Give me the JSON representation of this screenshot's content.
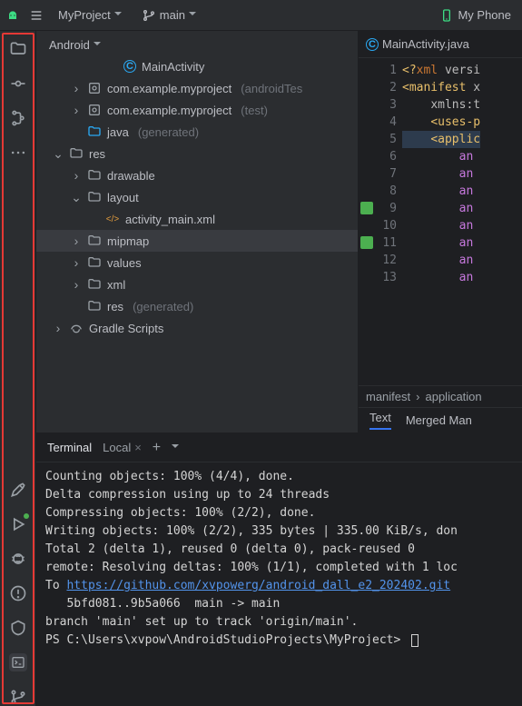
{
  "topbar": {
    "project": "MyProject",
    "branch": "main",
    "device": "My Phone"
  },
  "project_view": {
    "mode": "Android",
    "nodes": [
      {
        "depth": 3,
        "exp": "none",
        "icon": "class",
        "label": "MainActivity"
      },
      {
        "depth": 1,
        "exp": "closed",
        "icon": "pkg",
        "label": "com.example.myproject",
        "suffix": "(androidTes"
      },
      {
        "depth": 1,
        "exp": "closed",
        "icon": "pkg",
        "label": "com.example.myproject",
        "suffix": "(test)"
      },
      {
        "depth": 1,
        "exp": "none",
        "icon": "javadir",
        "label": "java",
        "suffix": "(generated)"
      },
      {
        "depth": 0,
        "exp": "open",
        "icon": "folder",
        "label": "res"
      },
      {
        "depth": 1,
        "exp": "closed",
        "icon": "folder",
        "label": "drawable"
      },
      {
        "depth": 1,
        "exp": "open",
        "icon": "folder",
        "label": "layout"
      },
      {
        "depth": 2,
        "exp": "none",
        "icon": "xml",
        "label": "activity_main.xml"
      },
      {
        "depth": 1,
        "exp": "closed",
        "icon": "folder",
        "label": "mipmap",
        "selected": true
      },
      {
        "depth": 1,
        "exp": "closed",
        "icon": "folder",
        "label": "values"
      },
      {
        "depth": 1,
        "exp": "closed",
        "icon": "folder",
        "label": "xml"
      },
      {
        "depth": 1,
        "exp": "none",
        "icon": "folder",
        "label": "res",
        "suffix": "(generated)"
      },
      {
        "depth": 0,
        "exp": "closed",
        "icon": "gradle",
        "label": "Gradle Scripts"
      }
    ]
  },
  "editor": {
    "tab": "MainActivity.java",
    "lines": [
      {
        "n": 1,
        "html": "<span class='t-ang'>&lt;?</span><span class='t-pi'>xml</span> <span class='t-attr'>versi</span>"
      },
      {
        "n": 2,
        "html": "<span class='t-ang'>&lt;</span><span class='t-tag'>manifest</span> <span class='t-attr'>x</span>"
      },
      {
        "n": 3,
        "html": "    <span class='t-attr'>xmlns:t</span>"
      },
      {
        "n": 4,
        "html": "    <span class='t-ang'>&lt;</span><span class='t-tag'>uses-p</span>"
      },
      {
        "n": 5,
        "hl": true,
        "html": "    <span class='t-ang'>&lt;</span><span class='t-app'>applic</span>"
      },
      {
        "n": 6,
        "html": "        <span class='t-an'>an</span>"
      },
      {
        "n": 7,
        "html": "        <span class='t-an'>an</span>"
      },
      {
        "n": 8,
        "html": "        <span class='t-an'>an</span>"
      },
      {
        "n": 9,
        "gicon": true,
        "html": "        <span class='t-an'>an</span>"
      },
      {
        "n": 10,
        "html": "        <span class='t-an'>an</span>"
      },
      {
        "n": 11,
        "gicon": true,
        "html": "        <span class='t-an'>an</span>"
      },
      {
        "n": 12,
        "html": "        <span class='t-an'>an</span>"
      },
      {
        "n": 13,
        "html": "        <span class='t-an'>an</span>"
      }
    ],
    "breadcrumb": [
      "manifest",
      "application"
    ],
    "bottom_tabs": [
      "Text",
      "Merged Man"
    ]
  },
  "terminal": {
    "title": "Terminal",
    "tab": "Local",
    "lines": [
      "Counting objects: 100% (4/4), done.",
      "Delta compression using up to 24 threads",
      "Compressing objects: 100% (2/2), done.",
      "Writing objects: 100% (2/2), 335 bytes | 335.00 KiB/s, don",
      "Total 2 (delta 1), reused 0 (delta 0), pack-reused 0",
      "remote: Resolving deltas: 100% (1/1), completed with 1 loc"
    ],
    "link_prefix": "To ",
    "link": "https://github.com/xvpowerg/android_dall_e2_202402.git",
    "after_link": [
      "   5bfd081..9b5a066  main -> main",
      "branch 'main' set up to track 'origin/main'."
    ],
    "prompt": "PS C:\\Users\\xvpow\\AndroidStudioProjects\\MyProject> "
  },
  "rail_top": [
    "folder",
    "commit",
    "structure",
    "more"
  ],
  "rail_bottom": [
    "build",
    "run",
    "debug",
    "problems",
    "gems",
    "terminal",
    "vcs"
  ]
}
